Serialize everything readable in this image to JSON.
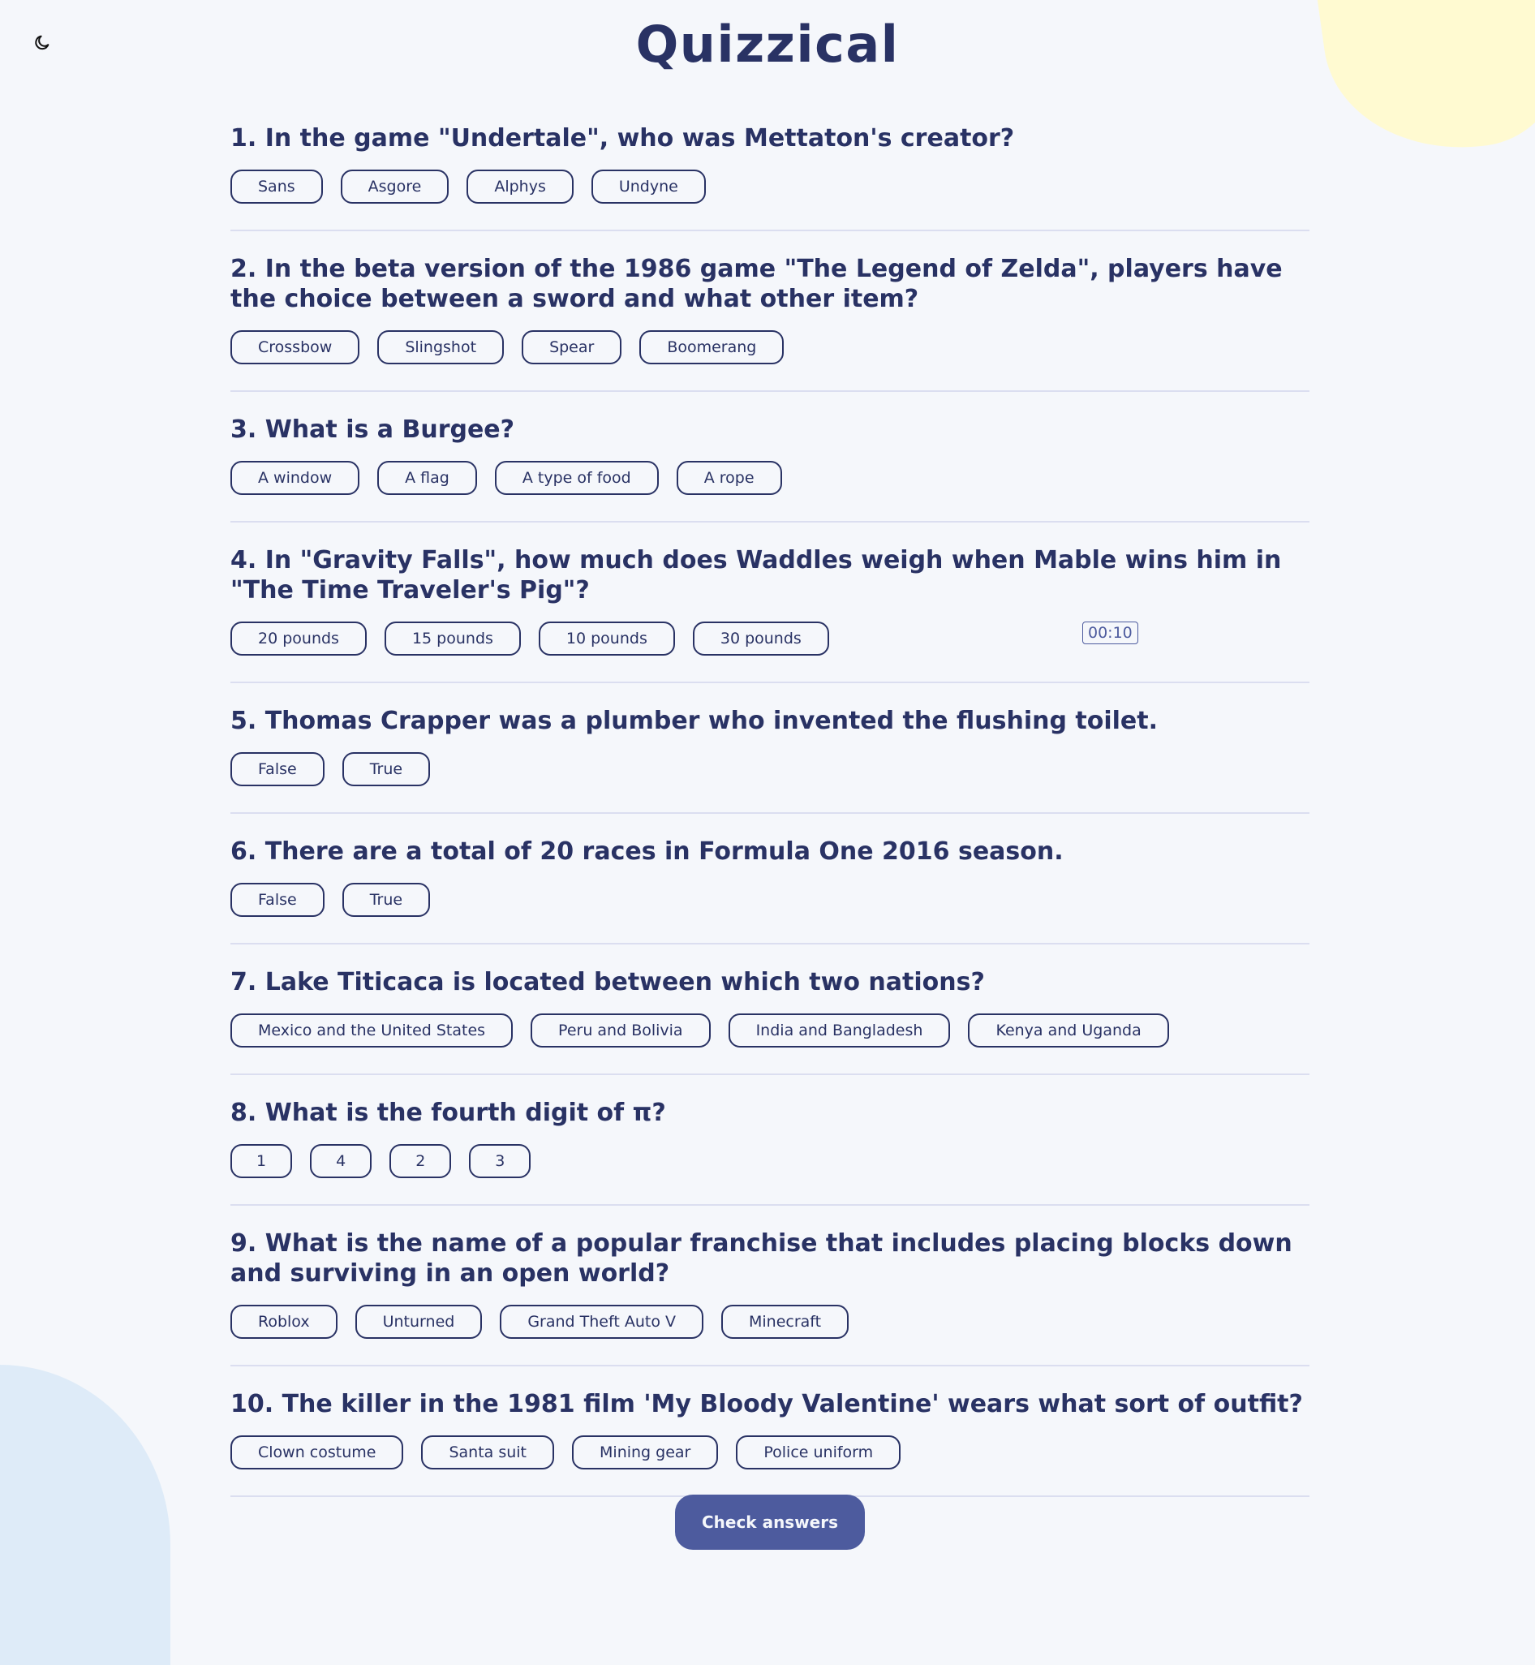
{
  "header": {
    "title": "Quizzical"
  },
  "icons": {
    "theme_toggle": "moon-icon"
  },
  "colors": {
    "primary": "#293264",
    "accent": "#4d5b9e",
    "blob_yellow": "#fffad1",
    "blob_blue": "#deebf8",
    "background": "#f5f7fb"
  },
  "timer": "00:10",
  "questions": [
    {
      "text": "1. In the game \"Undertale\", who was Mettaton's creator?",
      "answers": [
        "Sans",
        "Asgore",
        "Alphys",
        "Undyne"
      ]
    },
    {
      "text": "2. In the beta version of the 1986 game \"The Legend of Zelda\", players have the choice between a sword and what other item?",
      "answers": [
        "Crossbow",
        "Slingshot",
        "Spear",
        "Boomerang"
      ]
    },
    {
      "text": "3. What is a Burgee?",
      "answers": [
        "A window",
        "A flag",
        "A type of food",
        "A rope"
      ]
    },
    {
      "text": "4. In \"Gravity Falls\", how much does Waddles weigh when Mable wins him in \"The Time Traveler's Pig\"?",
      "answers": [
        "20 pounds",
        "15 pounds",
        "10 pounds",
        "30 pounds"
      ]
    },
    {
      "text": "5. Thomas Crapper was a plumber who invented the flushing toilet.",
      "answers": [
        "False",
        "True"
      ]
    },
    {
      "text": "6. There are a total of 20 races in Formula One 2016 season.",
      "answers": [
        "False",
        "True"
      ]
    },
    {
      "text": "7. Lake Titicaca is located between which two nations?",
      "answers": [
        "Mexico and the United States",
        "Peru and Bolivia",
        "India and Bangladesh",
        "Kenya and Uganda"
      ]
    },
    {
      "text": "8. What is the fourth digit of π?",
      "answers": [
        "1",
        "4",
        "2",
        "3"
      ]
    },
    {
      "text": "9. What is the name of a popular franchise that includes placing blocks down and surviving in an open world?",
      "answers": [
        "Roblox",
        "Unturned",
        "Grand Theft Auto V",
        "Minecraft"
      ]
    },
    {
      "text": "10. The killer in the 1981 film 'My Bloody Valentine' wears what sort of outfit?",
      "answers": [
        "Clown costume",
        "Santa suit",
        "Mining gear",
        "Police uniform"
      ]
    }
  ],
  "footer": {
    "check_label": "Check answers"
  }
}
